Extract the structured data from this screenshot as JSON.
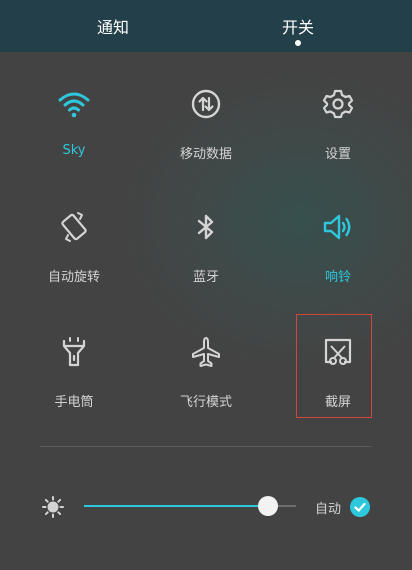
{
  "colors": {
    "accent": "#2ec8dc",
    "text": "#d4d4d4",
    "highlight": "#d0473d",
    "header": "#23404a"
  },
  "tabs": {
    "notify": "通知",
    "toggles": "开关",
    "selected": "toggles"
  },
  "tiles": {
    "wifi": {
      "label": "Sky",
      "icon": "wifi-icon",
      "active": true
    },
    "mobile_data": {
      "label": "移动数据",
      "icon": "mobile-data-icon",
      "active": false
    },
    "settings": {
      "label": "设置",
      "icon": "gear-icon",
      "active": false
    },
    "rotation": {
      "label": "自动旋转",
      "icon": "rotate-icon",
      "active": false
    },
    "bluetooth": {
      "label": "蓝牙",
      "icon": "bluetooth-icon",
      "active": false
    },
    "ringer": {
      "label": "响铃",
      "icon": "speaker-icon",
      "active": true
    },
    "flashlight": {
      "label": "手电筒",
      "icon": "flashlight-icon",
      "active": false
    },
    "airplane": {
      "label": "飞行模式",
      "icon": "airplane-icon",
      "active": false
    },
    "screenshot": {
      "label": "截屏",
      "icon": "screenshot-icon",
      "active": false,
      "highlighted": true
    }
  },
  "brightness": {
    "icon": "brightness-icon",
    "level": 0.87,
    "auto_label": "自动",
    "auto_checked": true
  }
}
